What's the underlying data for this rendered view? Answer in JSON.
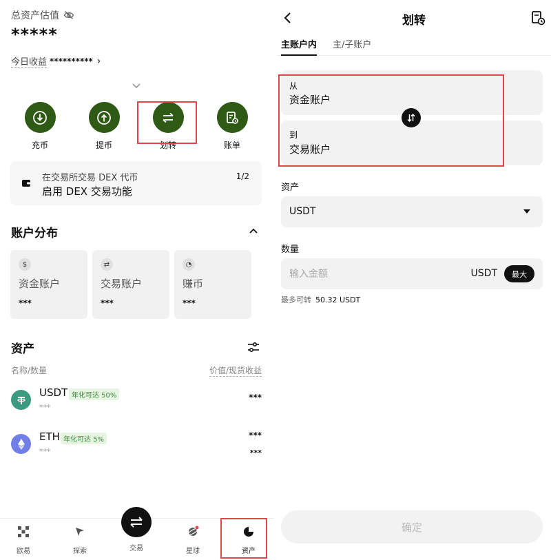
{
  "assets_page": {
    "total_label": "总资产估值",
    "total_value": "*****",
    "today_label": "今日收益",
    "today_value": "**********",
    "actions": [
      {
        "label": "充币",
        "icon": "deposit-icon"
      },
      {
        "label": "提币",
        "icon": "withdraw-icon"
      },
      {
        "label": "划转",
        "icon": "transfer-icon"
      },
      {
        "label": "账单",
        "icon": "bill-icon"
      }
    ],
    "dex_banner": {
      "line1": "在交易所交易 DEX 代币",
      "line2": "启用 DEX 交易功能",
      "page": "1/2"
    },
    "distribution_title": "账户分布",
    "accounts": [
      {
        "name": "资金账户",
        "value": "***",
        "icon": "money-bag-icon"
      },
      {
        "name": "交易账户",
        "value": "***",
        "icon": "swap-icon"
      },
      {
        "name": "赚币",
        "value": "***",
        "icon": "earn-icon"
      }
    ],
    "assets_title": "资产",
    "col_left": "名称/数量",
    "col_right": "价值/现货收益",
    "coins": [
      {
        "symbol": "USDT",
        "badge": "年化可达 50%",
        "sub": "***",
        "r1": "***",
        "r2": "",
        "color": "#3b9a7f"
      },
      {
        "symbol": "ETH",
        "badge": "年化可达 5%",
        "sub": "***",
        "r1": "***",
        "r2": "***",
        "color": "#6f7fe6"
      }
    ],
    "nav": [
      {
        "label": "欧易",
        "icon": "okx-logo-icon"
      },
      {
        "label": "探索",
        "icon": "explore-icon"
      },
      {
        "label": "交易",
        "icon": "trade-icon"
      },
      {
        "label": "星球",
        "icon": "planet-icon"
      },
      {
        "label": "资产",
        "icon": "assets-pie-icon"
      }
    ]
  },
  "transfer_page": {
    "title": "划转",
    "tabs": [
      "主账户内",
      "主/子账户"
    ],
    "from_label": "从",
    "from_account": "资金账户",
    "to_label": "到",
    "to_account": "交易账户",
    "asset_label": "资产",
    "asset_value": "USDT",
    "amount_label": "数量",
    "amount_placeholder": "输入金额",
    "amount_unit": "USDT",
    "max_label": "最大",
    "available_label": "最多可转",
    "available_value": "50.32 USDT",
    "confirm_label": "确定"
  },
  "colors": {
    "action_green": "#2f5a16",
    "highlight_red": "#e0474c",
    "card_gray": "#f2f2f2"
  }
}
